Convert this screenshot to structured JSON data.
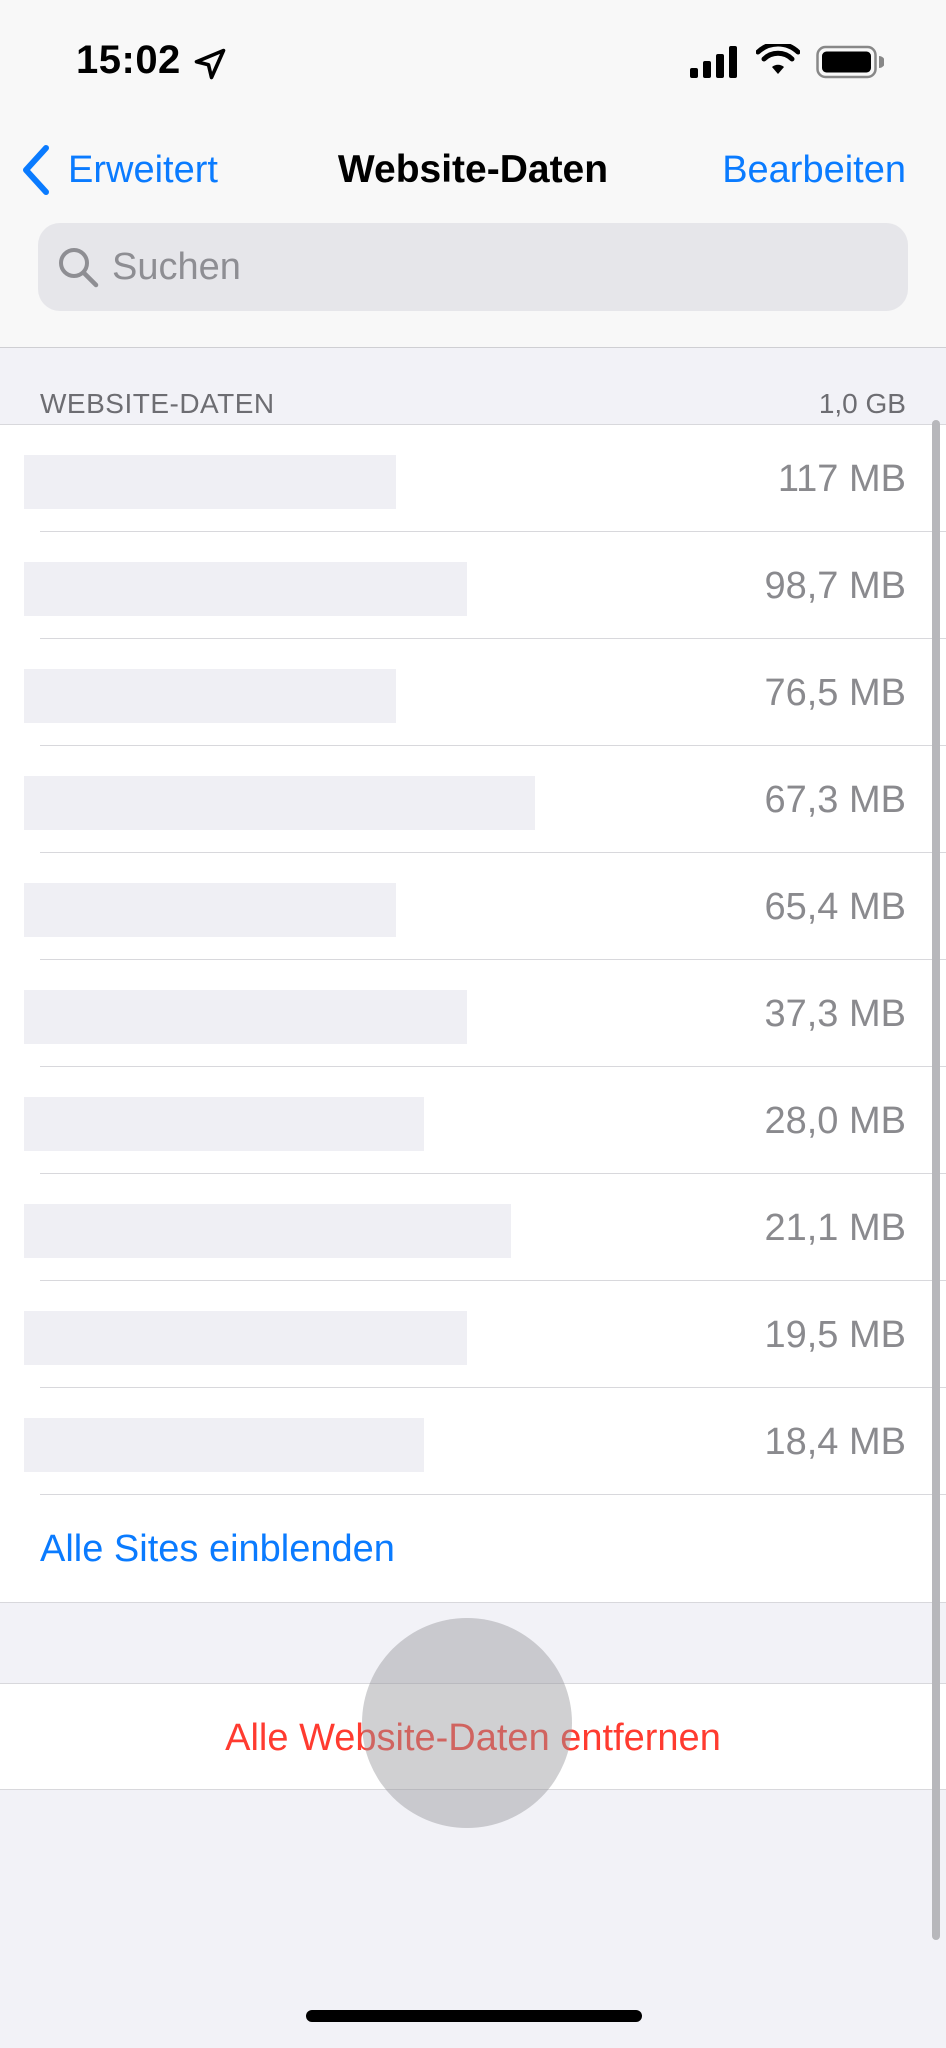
{
  "status_bar": {
    "time": "15:02"
  },
  "nav": {
    "back_label": "Erweitert",
    "title": "Website-Daten",
    "edit_label": "Bearbeiten"
  },
  "search": {
    "placeholder": "Suchen",
    "value": ""
  },
  "section": {
    "title": "WEBSITE-DATEN",
    "total": "1,0 GB"
  },
  "sites": [
    {
      "size": "117 MB"
    },
    {
      "size": "98,7 MB"
    },
    {
      "size": "76,5 MB"
    },
    {
      "size": "67,3 MB"
    },
    {
      "size": "65,4 MB"
    },
    {
      "size": "37,3 MB"
    },
    {
      "size": "28,0 MB"
    },
    {
      "size": "21,1 MB"
    },
    {
      "size": "19,5 MB"
    },
    {
      "size": "18,4 MB"
    }
  ],
  "show_all_label": "Alle Sites einblenden",
  "remove_all_label": "Alle Website-Daten entfernen",
  "colors": {
    "accent": "#0a7bff",
    "destructive": "#ff3b30",
    "secondary_text": "#8a8a8e",
    "background": "#f2f2f7"
  },
  "icons": [
    "location-arrow-icon",
    "signal-icon",
    "wifi-icon",
    "battery-icon",
    "chevron-left-icon",
    "search-icon"
  ]
}
